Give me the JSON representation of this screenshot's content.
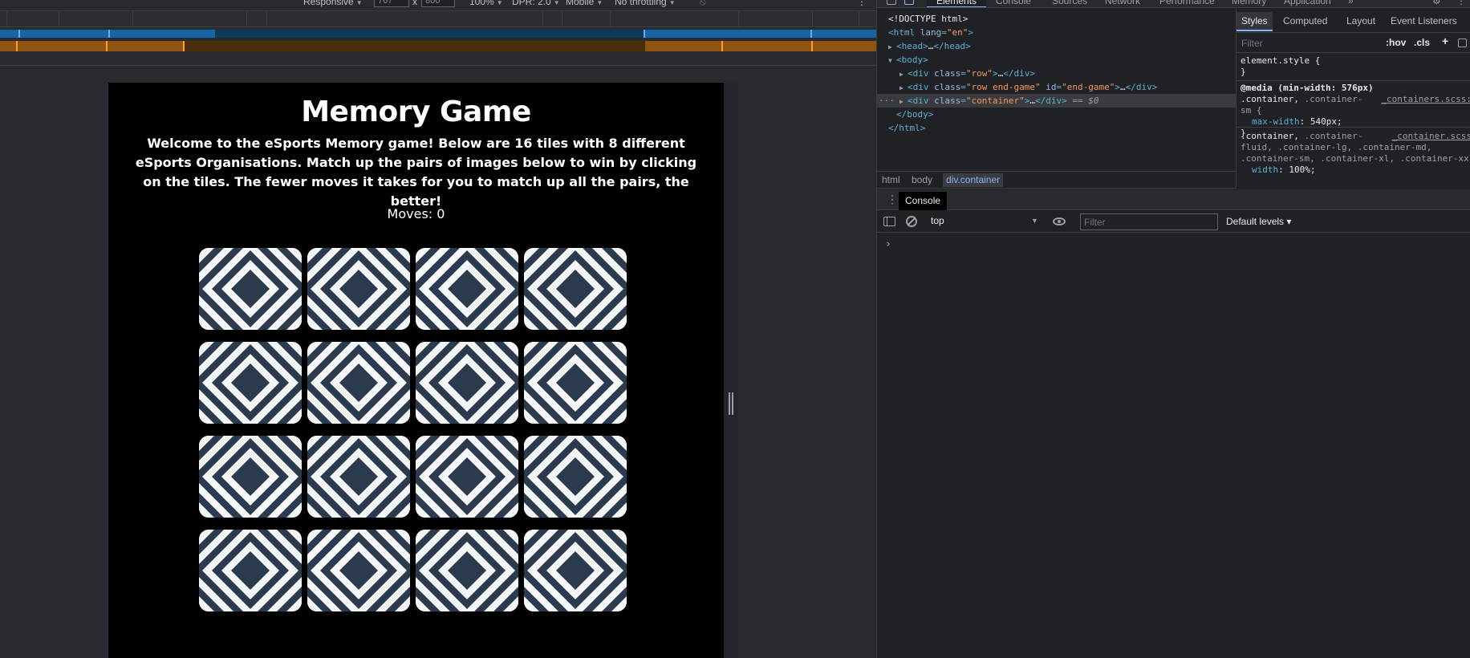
{
  "device_toolbar": {
    "dimensions_label": "Responsive",
    "width_value": "767",
    "height_value": "800",
    "times_label": "x",
    "zoom": "100%",
    "dpr": "DPR: 2.0",
    "device_type": "Mobile",
    "throttling": "No throttling"
  },
  "game": {
    "title": "Memory Game",
    "intro": "Welcome to the eSports Memory game! Below are 16 tiles with 8 different eSports Organisations. Match up the pairs of images below to win by clicking on the tiles. The fewer moves it takes for you to match up all the pairs, the better!",
    "moves_label": "Moves:",
    "moves_value": "0",
    "tile_count": 16,
    "tile_colors": {
      "dark": "#2b3a4d",
      "light": "#f5f6f7"
    }
  },
  "devtools": {
    "tabs": [
      "Elements",
      "Console",
      "Sources",
      "Network",
      "Performance",
      "Memory",
      "Application",
      "»"
    ],
    "active_tab": "Elements",
    "dom": [
      {
        "text": "<!DOCTYPE html>"
      },
      {
        "open": "<html ",
        "attr": "lang",
        "val": "\"en\"",
        "close": ">"
      },
      {
        "tag": "<head>",
        "ell": "…",
        "end": "</head>"
      },
      {
        "tag": "<body>"
      },
      {
        "open": "<div ",
        "attr": "class",
        "val": "\"row\"",
        "close": ">",
        "ell": "…",
        "end": "</div>"
      },
      {
        "open": "<div ",
        "attr": "class",
        "val": "\"row end-game\"",
        "attr2": "id",
        "val2": "\"end-game\"",
        "close": ">",
        "ell": "…",
        "end": "</div>"
      },
      {
        "open": "<div ",
        "attr": "class",
        "val": "\"container\"",
        "close": ">",
        "ell": "…",
        "end": "</div>",
        "suffix": " == $0"
      },
      {
        "tag": "</body>"
      },
      {
        "tag": "</html>"
      }
    ],
    "breadcrumbs": [
      "html",
      "body",
      "div.container"
    ],
    "styles_tabs": [
      "Styles",
      "Computed",
      "Layout",
      "Event Listeners"
    ],
    "styles_filter_placeholder": "Filter",
    "hov": ":hov",
    "cls": ".cls",
    "plus": "+",
    "css_rules": {
      "element_style": "element.style {",
      "close": "}",
      "media": "@media (min-width: 576px)",
      "rule1_sel_a": ".container,",
      "rule1_sel_b": ".container-",
      "rule1_sel_c": "sm {",
      "rule1_src": "_containers.scss:",
      "rule1_prop": "max-width",
      "rule1_val": "540px;",
      "rule2_sel_a": ".container,",
      "rule2_sel_b": ".container-",
      "rule2_src": "_container.scss",
      "rule2_line2": "fluid, .container-lg, .container-md,",
      "rule2_line3": ".container-sm, .container-xl, .container-xxl",
      "rule2_prop": "width",
      "rule2_val": "100%;"
    },
    "drawer_tab": "Console",
    "context": "top",
    "console_filter_placeholder": "Filter",
    "levels": "Default levels ▾",
    "prompt": "›"
  }
}
